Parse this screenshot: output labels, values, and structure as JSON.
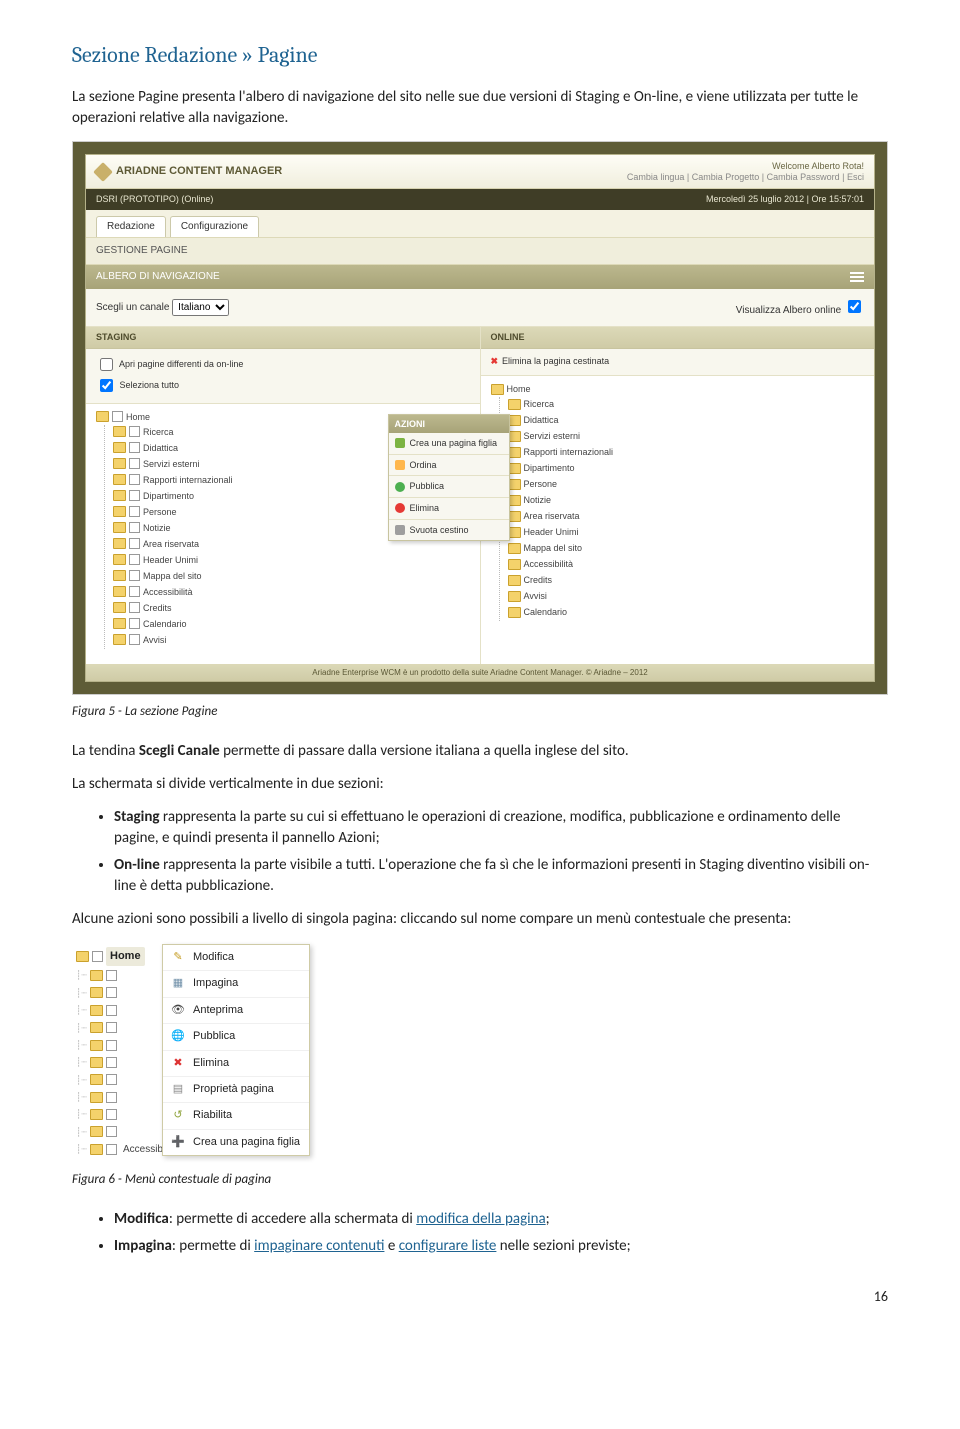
{
  "heading": "Sezione Redazione » Pagine",
  "intro": "La sezione Pagine presenta l'albero di navigazione del sito nelle sue due versioni di Staging e On-line, e viene utilizzata per tutte le operazioni relative alla navigazione.",
  "fig5caption": "Figura 5 - La sezione Pagine",
  "para_tendina_pre": "La tendina ",
  "para_tendina_bold": "Scegli Canale",
  "para_tendina_post": " permette di passare dalla versione italiana a quella inglese del sito.",
  "para_divide": "La schermata si divide verticalmente in due sezioni:",
  "bullets_main": {
    "staging_b": "Staging",
    "staging_t": " rappresenta la parte su cui si effettuano le operazioni di creazione, modifica, pubblicazione e ordinamento delle pagine, e quindi presenta il pannello Azioni;",
    "online_b": "On-line",
    "online_t": " rappresenta la parte visibile a tutti. L'operazione che fa sì che le informazioni presenti in Staging diventino visibili on-line è detta pubblicazione."
  },
  "para_azioni": "Alcune azioni sono possibili a livello di singola pagina: cliccando sul nome compare un menù contestuale che presenta:",
  "fig6caption": "Figura 6 - Menù contestuale di pagina",
  "bullets_bottom": {
    "mod_b": "Modifica",
    "mod_t1": ": permette di accedere alla schermata di ",
    "mod_link": "modifica della pagina",
    "mod_t2": ";",
    "imp_b": "Impagina",
    "imp_t1": ": permette di ",
    "imp_link1": "impaginare contenuti",
    "imp_mid": " e ",
    "imp_link2": "configurare liste",
    "imp_t2": " nelle sezioni previste;"
  },
  "page_number": "16",
  "app": {
    "brand": "ARIADNE CONTENT MANAGER",
    "welcome": "Welcome Alberto Rota!",
    "top_links": "Cambia lingua | Cambia Progetto | Cambia Password | Esci",
    "project": "DSRI (PROTOTIPO) (Online)",
    "datetime": "Mercoledì 25 luglio 2012 | Ore 15:57:01",
    "tab1": "Redazione",
    "tab2": "Configurazione",
    "section": "GESTIONE PAGINE",
    "nav_label": "ALBERO DI NAVIGAZIONE",
    "channel_label": "Scegli un canale",
    "channel_value": "Italiano",
    "view_full": "Visualizza Albero online",
    "col_staging": "STAGING",
    "col_online": "ONLINE",
    "opt1": "Apri pagine differenti da on-line",
    "opt2": "Seleziona tutto",
    "online_del": "Elimina la pagina cestinata",
    "actions_header": "AZIONI",
    "actions": [
      "Crea una pagina figlia",
      "Ordina",
      "Pubblica",
      "Elimina",
      "Svuota cestino"
    ],
    "tree_staging": [
      "Home",
      "Ricerca",
      "Didattica",
      "Servizi esterni",
      "Rapporti internazionali",
      "Dipartimento",
      "Persone",
      "Notizie",
      "Area riservata",
      "Header Unimi",
      "Mappa del sito",
      "Accessibilità",
      "Credits",
      "Calendario",
      "Avvisi"
    ],
    "tree_online": [
      "Home",
      "Ricerca",
      "Didattica",
      "Servizi esterni",
      "Rapporti internazionali",
      "Dipartimento",
      "Persone",
      "Notizie",
      "Area riservata",
      "Header Unimi",
      "Mappa del sito",
      "Accessibilità",
      "Credits",
      "Avvisi",
      "Calendario"
    ],
    "footer": "Ariadne Enterprise WCM è un prodotto della suite Ariadne Content Manager. © Ariadne – 2012"
  },
  "ctx": {
    "home": "Home",
    "last": "Accessibilità",
    "items": [
      "Modifica",
      "Impagina",
      "Anteprima",
      "Pubblica",
      "Elimina",
      "Proprietà pagina",
      "Riabilita",
      "Crea una pagina figlia"
    ]
  }
}
